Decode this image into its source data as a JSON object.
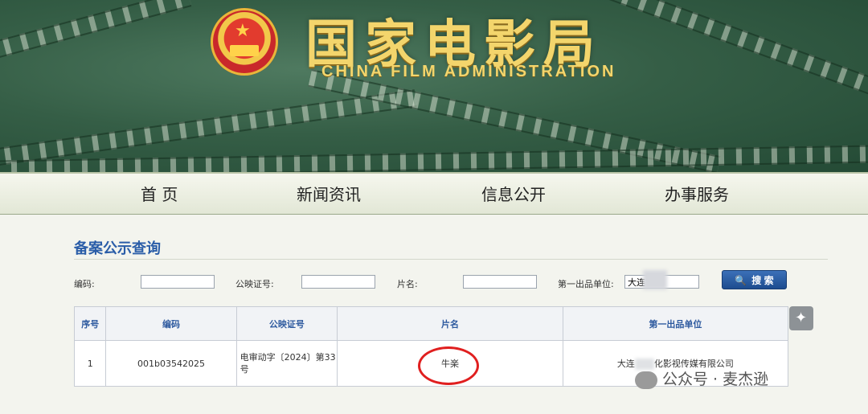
{
  "header": {
    "title_cn": "国家电影局",
    "title_en": "CHINA FILM ADMINISTRATION"
  },
  "nav": [
    "首 页",
    "新闻资讯",
    "信息公开",
    "办事服务"
  ],
  "section_title": "备案公示查询",
  "search": {
    "code_label": "编码:",
    "code_value": "",
    "cert_label": "公映证号:",
    "cert_value": "",
    "film_label": "片名:",
    "film_value": "",
    "producer_label": "第一出品单位:",
    "producer_value": "大连",
    "button_label": "搜 索"
  },
  "table": {
    "headers": [
      "序号",
      "编码",
      "公映证号",
      "片名",
      "第一出品单位"
    ],
    "rows": [
      {
        "index": "1",
        "code": "001b03542025",
        "cert_line1": "电审动字〔2024〕第33",
        "cert_line2": "号",
        "film": "牛楽",
        "producer_prefix": "大连",
        "producer_suffix": "化影视传媒有限公司"
      }
    ]
  },
  "watermark": "公众号 · 麦杰逊",
  "colors": {
    "accent_blue": "#2a5da8",
    "annotation_red": "#e01f1f"
  }
}
